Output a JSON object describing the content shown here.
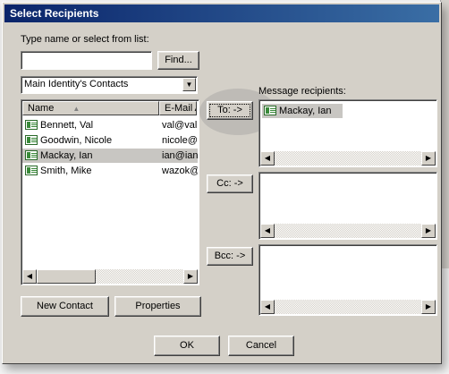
{
  "dialog": {
    "title": "Select Recipients",
    "search_label": "Type name or select from list:",
    "search_value": "",
    "find_button": "Find...",
    "address_book": "Main Identity's Contacts",
    "columns": [
      "Name",
      "E-Mail A"
    ],
    "contacts": [
      {
        "name": "Bennett, Val",
        "email": "val@val"
      },
      {
        "name": "Goodwin, Nicole",
        "email": "nicole@"
      },
      {
        "name": "Mackay, Ian",
        "email": "ian@ian",
        "selected": true
      },
      {
        "name": "Smith, Mike",
        "email": "wazok@"
      }
    ],
    "recipients_label": "Message recipients:",
    "to_button": "To: ->",
    "cc_button": "Cc: ->",
    "bcc_button": "Bcc: ->",
    "to_recipients": [
      "Mackay, Ian"
    ],
    "new_contact_button": "New Contact",
    "properties_button": "Properties",
    "ok_button": "OK",
    "cancel_button": "Cancel"
  },
  "colors": {
    "titlebar": "#0a246a",
    "face": "#d4d0c8",
    "selection": "#c8c6c2"
  }
}
